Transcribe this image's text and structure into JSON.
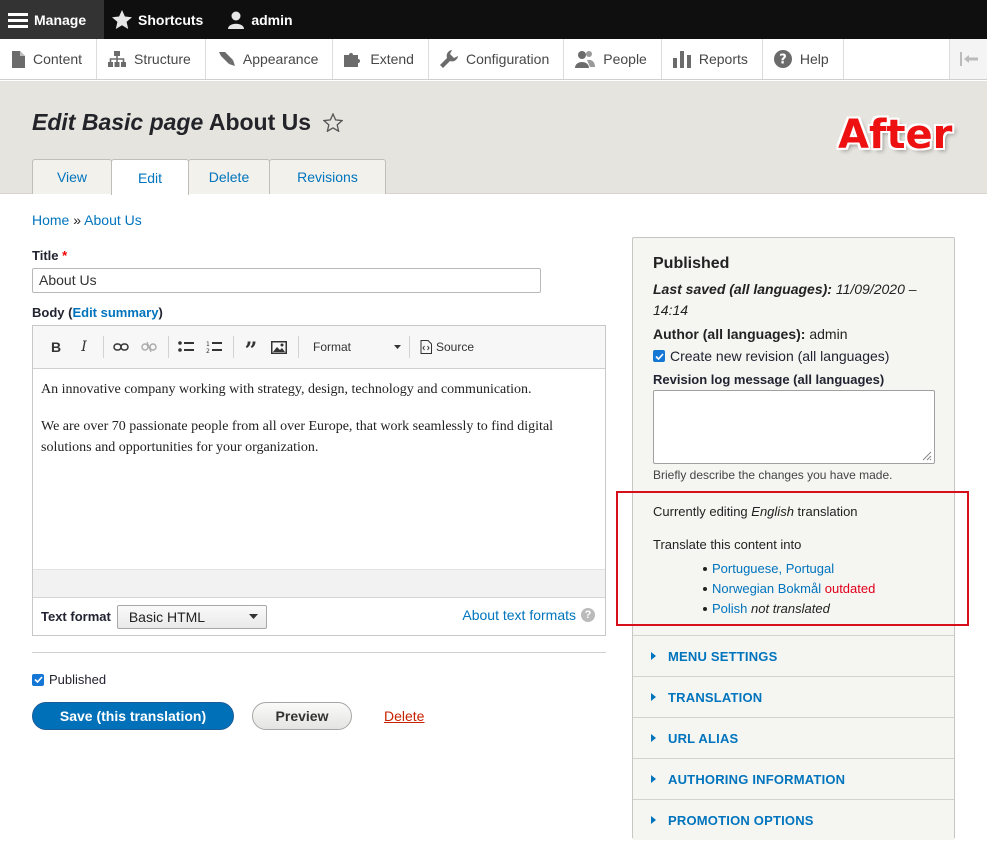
{
  "toolbar": {
    "manage": "Manage",
    "shortcuts": "Shortcuts",
    "user": "admin"
  },
  "tray": {
    "items": [
      {
        "label": "Content",
        "icon": "page-icon"
      },
      {
        "label": "Structure",
        "icon": "sitemap-icon"
      },
      {
        "label": "Appearance",
        "icon": "brush-icon"
      },
      {
        "label": "Extend",
        "icon": "puzzle-icon"
      },
      {
        "label": "Configuration",
        "icon": "wrench-icon"
      },
      {
        "label": "People",
        "icon": "people-icon"
      },
      {
        "label": "Reports",
        "icon": "bar-chart-icon"
      },
      {
        "label": "Help",
        "icon": "help-icon"
      }
    ]
  },
  "header": {
    "title_prefix": "Edit Basic page",
    "title_node": "About Us",
    "annotation": "After"
  },
  "tabs": [
    "View",
    "Edit",
    "Delete",
    "Revisions"
  ],
  "breadcrumb": {
    "home": "Home",
    "separator": "»",
    "current": "About Us"
  },
  "form": {
    "title_label": "Title",
    "required_mark": "*",
    "title_value": "About Us",
    "body_label": "Body",
    "edit_summary": "Edit summary",
    "editor_format": "Format",
    "editor_source": "Source",
    "body_paragraphs": [
      "An innovative company working with strategy, design, technology and communication.",
      "We are over 70 passionate people from all over Europe, that work seamlessly to find digital solutions and opportunities for your organization."
    ],
    "text_format_label": "Text format",
    "text_format_value": "Basic HTML",
    "about_formats": "About text formats",
    "published_label": "Published",
    "save_button": "Save (this translation)",
    "preview_button": "Preview",
    "delete_link": "Delete"
  },
  "sidebar": {
    "status": "Published",
    "last_saved_label": "Last saved (all languages):",
    "last_saved_value": "11/09/2020 – 14:14",
    "author_label": "Author (all languages):",
    "author_value": "admin",
    "new_revision": "Create new revision (all languages)",
    "revision_log_label": "Revision log message (all languages)",
    "revision_log_desc": "Briefly describe the changes you have made.",
    "editing_prefix": "Currently editing",
    "editing_language": "English",
    "editing_suffix": "translation",
    "translate_intro": "Translate this content into",
    "translations": [
      {
        "language": "Portuguese, Portugal",
        "status": ""
      },
      {
        "language": "Norwegian Bokmål",
        "status": "outdated"
      },
      {
        "language": "Polish",
        "status": "not translated"
      }
    ],
    "accordion": [
      "MENU SETTINGS",
      "TRANSLATION",
      "URL ALIAS",
      "AUTHORING INFORMATION",
      "PROMOTION OPTIONS"
    ]
  },
  "colors": {
    "link": "#0074bd",
    "primary_button": "#0071b8",
    "annotation": "#ee1111",
    "outdated": "#e0001a"
  }
}
